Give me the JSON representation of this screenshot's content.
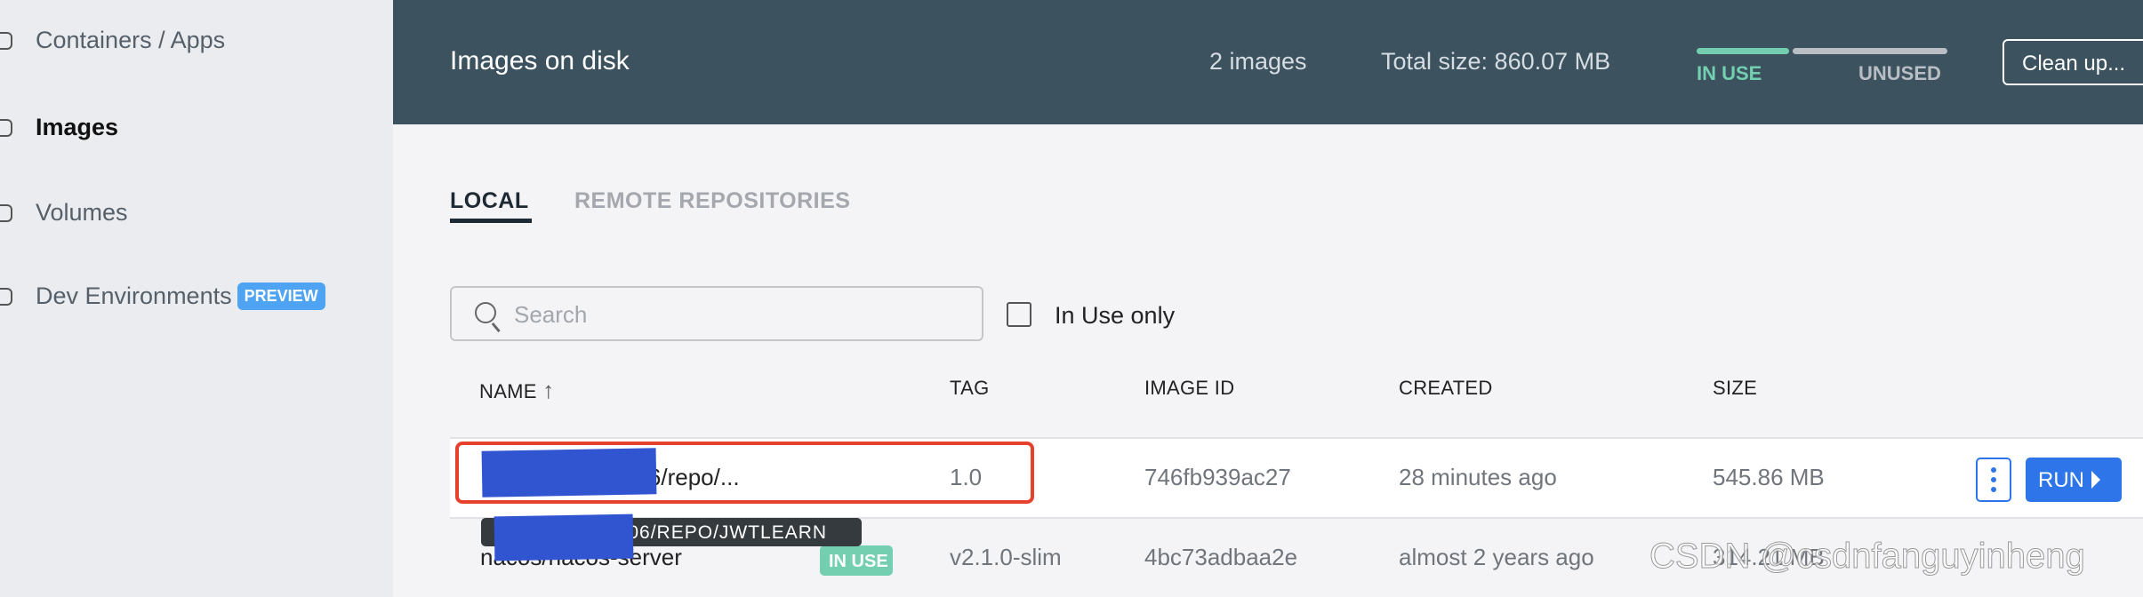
{
  "sidebar": {
    "items": [
      {
        "label": "Containers / Apps",
        "icon": "container-icon"
      },
      {
        "label": "Images",
        "icon": "cloud-icon",
        "active": true
      },
      {
        "label": "Volumes",
        "icon": "volume-icon"
      },
      {
        "label": "Dev Environments",
        "icon": "dev-env-icon",
        "badge": "PREVIEW"
      }
    ]
  },
  "header": {
    "title": "Images on disk",
    "count": "2 images",
    "total_size": "Total size: 860.07 MB",
    "usage": {
      "in_use_label": "IN USE",
      "unused_label": "UNUSED",
      "in_use_fraction": 0.37,
      "in_use_color": "#74cfb0",
      "unused_color": "#b8bec4"
    },
    "cleanup_label": "Clean up..."
  },
  "tabs": [
    {
      "label": "LOCAL",
      "active": true
    },
    {
      "label": "REMOTE REPOSITORIES"
    }
  ],
  "search": {
    "placeholder": "Search",
    "value": ""
  },
  "filter": {
    "label": "In Use only",
    "checked": false
  },
  "table": {
    "columns": [
      "NAME",
      "TAG",
      "IMAGE ID",
      "CREATED",
      "SIZE"
    ],
    "rows": [
      {
        "name": "306/repo/...",
        "tag": "1.0",
        "image_id": "746fb939ac27",
        "created": "28 minutes ago",
        "size": "545.86 MB"
      },
      {
        "name": "nacos/nacos-server",
        "tag": "v2.1.0-slim",
        "image_id": "4bc73adbaa2e",
        "created": "almost 2 years ago",
        "size": "314.21 MB",
        "badge": "IN USE"
      }
    ]
  },
  "tooltip": "3306/REPO/JWTLEARN",
  "row_actions": {
    "run_label": "RUN"
  },
  "watermark": "CSDN @csdnfanguyinheng"
}
